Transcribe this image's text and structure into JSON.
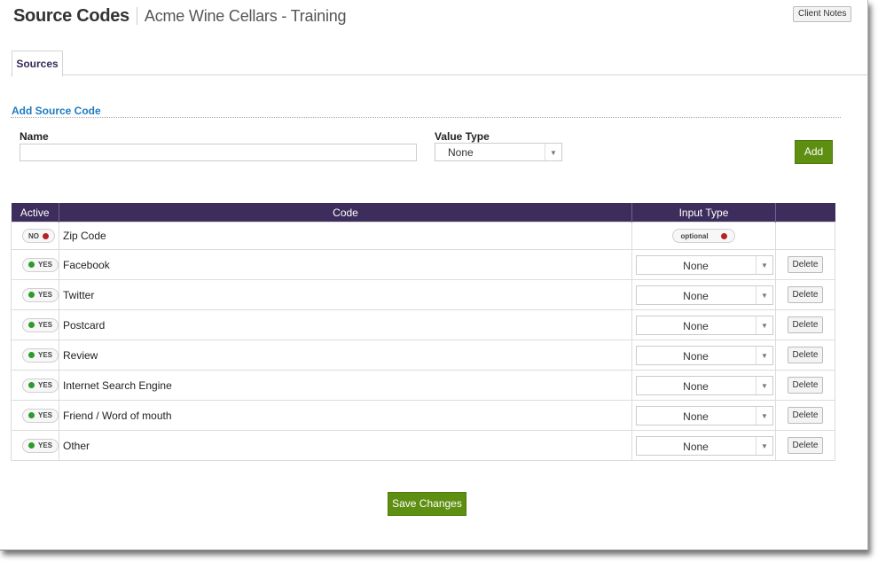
{
  "header": {
    "title": "Source Codes",
    "subtitle": "Acme Wine Cellars - Training",
    "client_notes_label": "Client Notes"
  },
  "tabs": [
    {
      "label": "Sources",
      "active": true
    }
  ],
  "add_form": {
    "section_title": "Add Source Code",
    "name_label": "Name",
    "name_value": "",
    "value_type_label": "Value Type",
    "value_type_selected": "None",
    "add_label": "Add"
  },
  "table": {
    "headers": {
      "active": "Active",
      "code": "Code",
      "input_type": "Input Type",
      "actions": ""
    },
    "rows": [
      {
        "active": "NO",
        "code": "Zip Code",
        "input_type": "optional",
        "delete": ""
      },
      {
        "active": "YES",
        "code": "Facebook",
        "input_type": "None",
        "delete": "Delete"
      },
      {
        "active": "YES",
        "code": "Twitter",
        "input_type": "None",
        "delete": "Delete"
      },
      {
        "active": "YES",
        "code": "Postcard",
        "input_type": "None",
        "delete": "Delete"
      },
      {
        "active": "YES",
        "code": "Review",
        "input_type": "None",
        "delete": "Delete"
      },
      {
        "active": "YES",
        "code": "Internet Search Engine",
        "input_type": "None",
        "delete": "Delete"
      },
      {
        "active": "YES",
        "code": "Friend / Word of mouth",
        "input_type": "None",
        "delete": "Delete"
      },
      {
        "active": "YES",
        "code": "Other",
        "input_type": "None",
        "delete": "Delete"
      }
    ]
  },
  "footer": {
    "save_label": "Save Changes"
  },
  "colors": {
    "header_bg": "#3d2d5c",
    "accent_blue": "#1e7bc2",
    "button_green": "#5f8f12",
    "toggle_on": "#2e9a2e",
    "toggle_off": "#b42222"
  },
  "icons": {
    "select_arrow": "chevron-down-icon",
    "status_dot": "status-dot-icon"
  }
}
